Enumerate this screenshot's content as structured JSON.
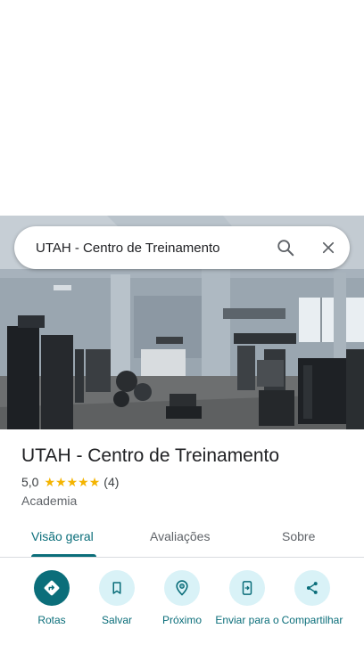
{
  "search": {
    "query": "UTAH - Centro de Treinamento"
  },
  "hero": {
    "photo": "gym-interior-photo"
  },
  "place": {
    "title": "UTAH - Centro de Treinamento",
    "rating": "5,0",
    "rating_value": 5,
    "review_count": "(4)",
    "category": "Academia"
  },
  "tabs": [
    {
      "label": "Visão geral",
      "active": true
    },
    {
      "label": "Avaliações",
      "active": false
    },
    {
      "label": "Sobre",
      "active": false
    }
  ],
  "actions": [
    {
      "label": "Rotas",
      "icon": "directions-icon"
    },
    {
      "label": "Salvar",
      "icon": "bookmark-icon"
    },
    {
      "label": "Próximo",
      "icon": "nearby-icon"
    },
    {
      "label": "Enviar para o",
      "icon": "send-to-phone-icon"
    },
    {
      "label": "Compartilhar",
      "icon": "share-icon"
    }
  ],
  "colors": {
    "accent": "#0b6e7a",
    "accent_light": "#d9f2f7",
    "star": "#f4b400"
  }
}
